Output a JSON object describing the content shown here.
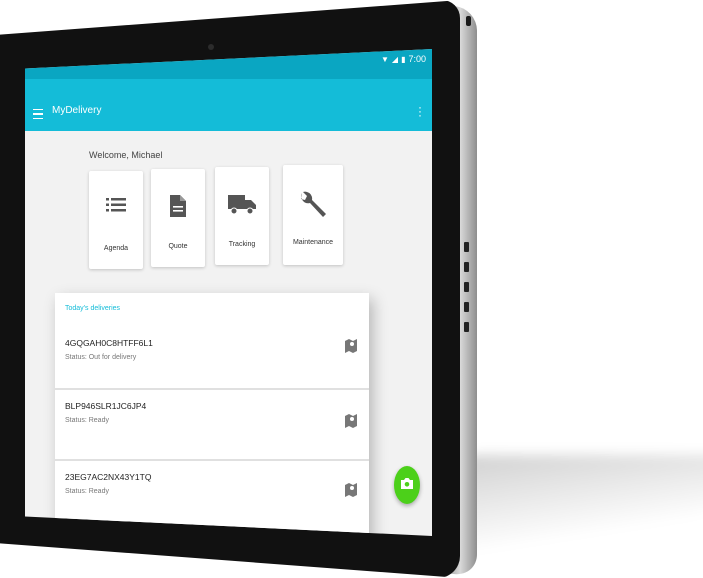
{
  "status_bar": {
    "time": "7:00"
  },
  "app_bar": {
    "title": "MyDelivery"
  },
  "welcome": "Welcome, Michael",
  "tiles": [
    {
      "label": "Agenda",
      "icon": "list-icon"
    },
    {
      "label": "Quote",
      "icon": "document-icon"
    },
    {
      "label": "Tracking",
      "icon": "truck-icon"
    },
    {
      "label": "Maintenance",
      "icon": "wrench-icon"
    }
  ],
  "deliveries": {
    "heading": "Today's deliveries",
    "items": [
      {
        "code": "4GQGAH0C8HTFF6L1",
        "status": "Status: Out for delivery"
      },
      {
        "code": "BLP946SLR1JC6JP4",
        "status": "Status: Ready"
      },
      {
        "code": "23EG7AC2NX43Y1TQ",
        "status": "Status: Ready"
      }
    ]
  },
  "colors": {
    "status_bar": "#0aa6c2",
    "app_bar": "#14bcd8",
    "accent": "#14bcd8",
    "fab": "#4cd01a"
  },
  "fab": {
    "icon": "camera-icon"
  }
}
